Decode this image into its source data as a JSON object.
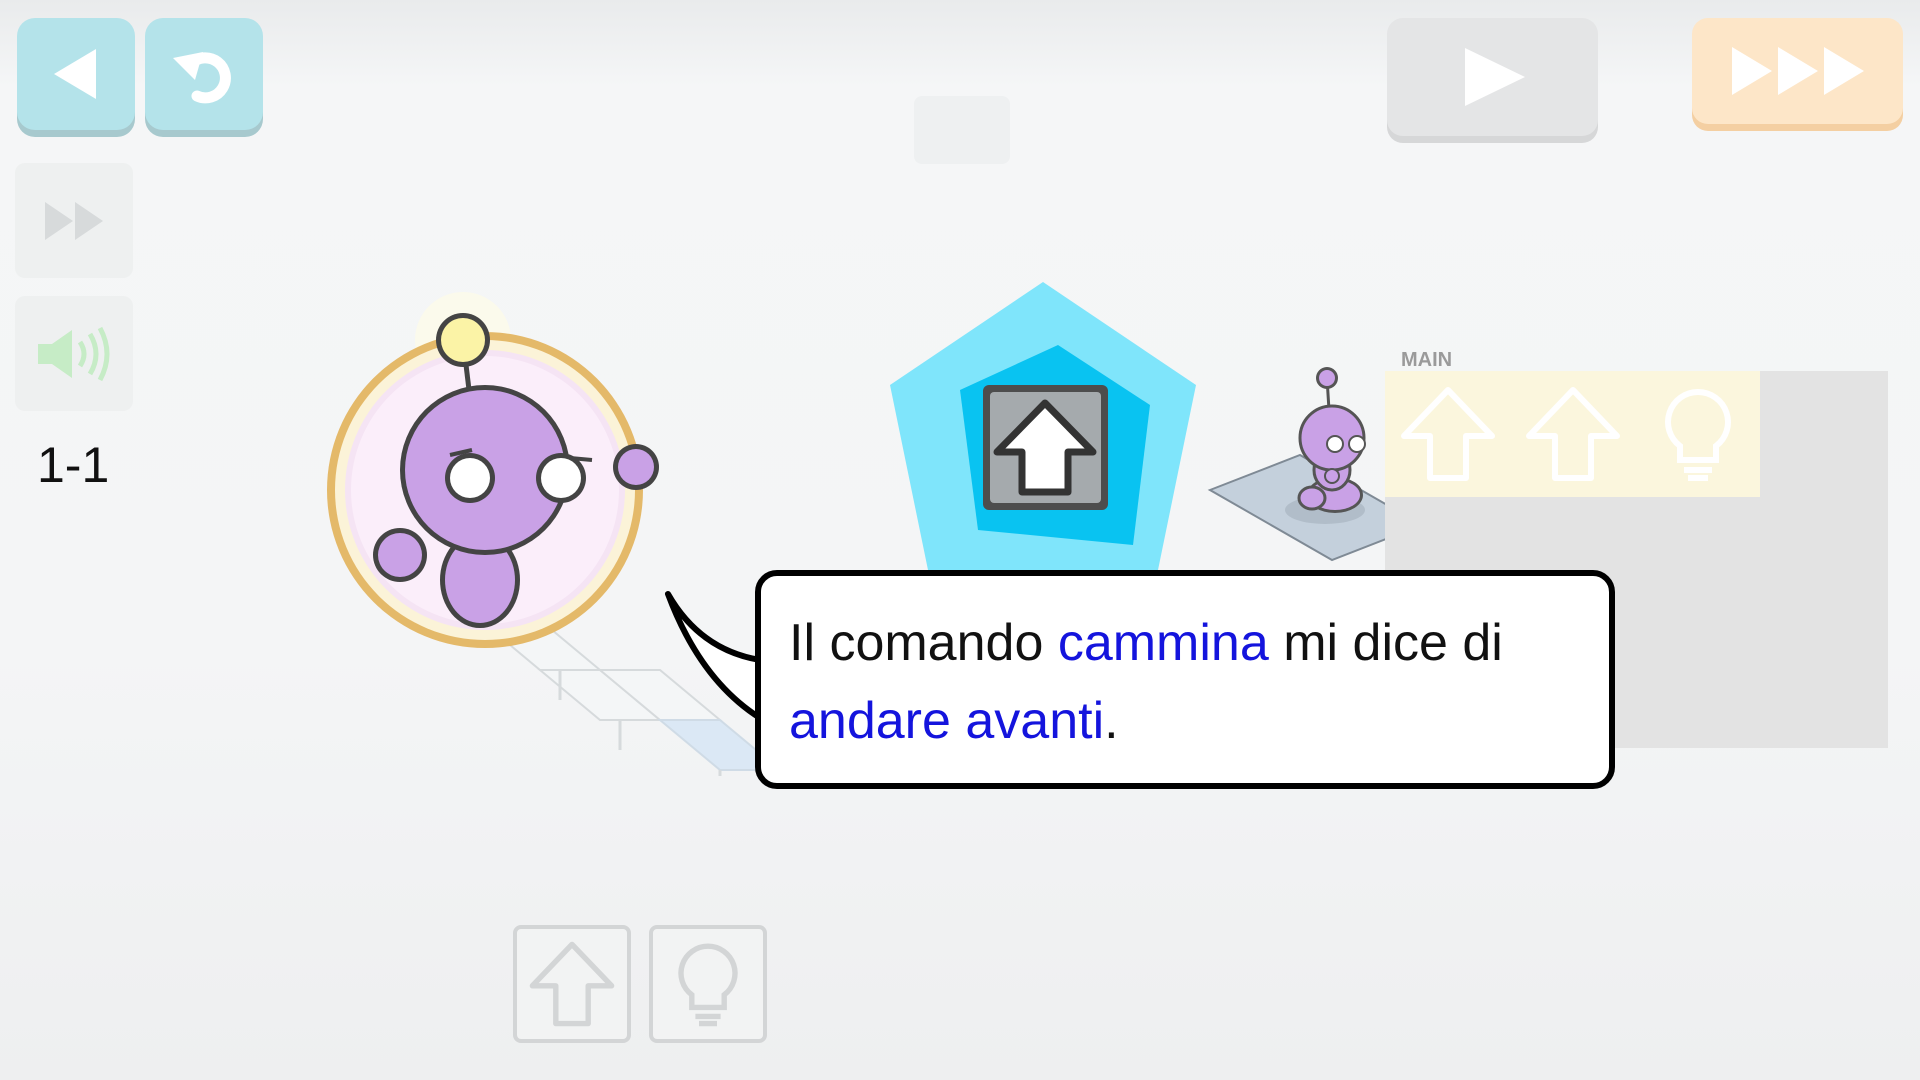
{
  "toolbar": {
    "back_icon": "back-triangle-icon",
    "undo_icon": "undo-icon",
    "play_icon": "play-icon",
    "fast_forward_icon": "triple-arrow-icon",
    "skip_icon": "skip-icon",
    "sound_icon": "speaker-icon"
  },
  "level": {
    "label": "1-1"
  },
  "program": {
    "title": "MAIN",
    "slots": [
      "walk-arrow-icon",
      "walk-arrow-icon",
      "lightbulb-icon"
    ]
  },
  "commands": [
    "walk-arrow-icon",
    "lightbulb-icon"
  ],
  "dialog": {
    "part1": "Il comando ",
    "highlight1": "cammina",
    "part2": " mi dice di ",
    "highlight2": "andare avanti",
    "part3": "."
  },
  "colors": {
    "highlight": "#1414dd",
    "robot": "#c9a1e6",
    "gem": "#7fe5fb",
    "blue_button": "#b4e3ea",
    "orange_button": "#fde6c8"
  }
}
